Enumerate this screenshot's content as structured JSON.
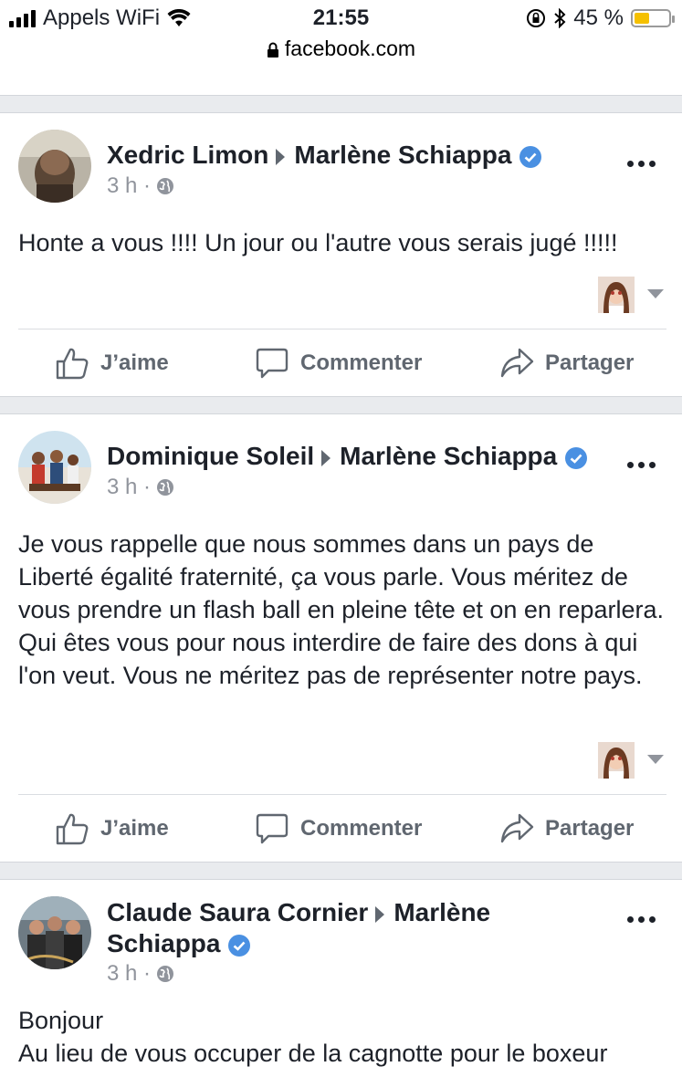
{
  "status": {
    "carrier": "Appels WiFi",
    "time": "21:55",
    "battery_pct": "45 %",
    "battery_level": 0.45
  },
  "browser": {
    "url": "facebook.com"
  },
  "actions": {
    "like": "J’aime",
    "comment": "Commenter",
    "share": "Partager"
  },
  "posts": [
    {
      "author": "Xedric Limon",
      "target": "Marlène Schiappa",
      "time": "3 h ·",
      "text": "Honte a vous !!!! Un jour ou l'autre vous serais jugé !!!!!"
    },
    {
      "author": "Dominique Soleil",
      "target": "Marlène Schiappa",
      "time": "3 h ·",
      "text": "Je vous rappelle que nous sommes dans un pays de Liberté égalité fraternité, ça vous parle. Vous méritez de vous prendre un flash ball en pleine tête et on en reparlera. Qui êtes vous pour nous interdire de faire des dons à qui l'on veut. Vous ne méritez pas de représenter notre pays."
    },
    {
      "author": "Claude Saura Cornier",
      "target_part1": "Marlène",
      "target_part2": "Schiappa",
      "time": "3 h ·",
      "text_line1": "Bonjour",
      "text_line2": "Au lieu de vous occuper de la cagnotte pour le boxeur"
    }
  ],
  "colors": {
    "verified": "#4a90e2",
    "separator": "#e9ebee",
    "action_text": "#606770"
  }
}
